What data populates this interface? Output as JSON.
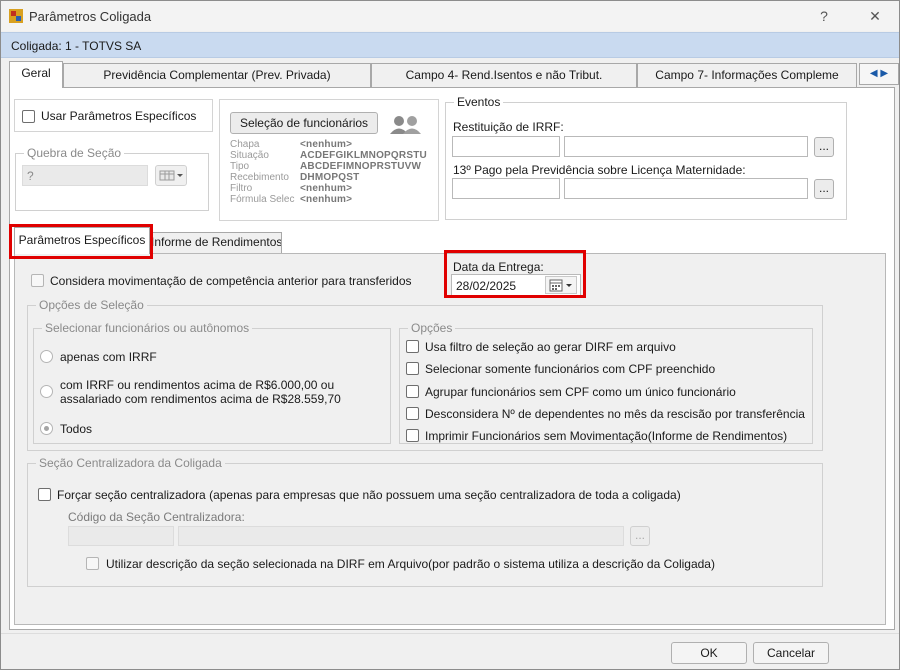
{
  "window": {
    "title": "Parâmetros Coligada",
    "help": "?",
    "close": "✕"
  },
  "coligada": "Coligada: 1 - TOTVS SA",
  "tabs": [
    "Geral",
    "Previdência Complementar (Prev. Privada)",
    "Campo 4- Rend.Isentos e não Tribut.",
    "Campo 7- Informações Compleme"
  ],
  "top": {
    "usar_parametros": "Usar Parâmetros Específicos",
    "quebra_secao": "Quebra de Seção",
    "quebra_value": "?",
    "selecao_button": "Seleção de funcionários",
    "selecao_info": [
      {
        "k": "Chapa",
        "v": "<nenhum>"
      },
      {
        "k": "Situação",
        "v": "ACDEFGIKLMNOPQRSTU"
      },
      {
        "k": "Tipo",
        "v": "ABCDEFIMNOPRSTUVW"
      },
      {
        "k": "Recebimento",
        "v": "DHMOPQST"
      },
      {
        "k": "Filtro",
        "v": "<nenhum>"
      },
      {
        "k": "Fórmula Selec",
        "v": "<nenhum>"
      }
    ],
    "eventos": "Eventos",
    "restituicao": "Restituição de IRRF:",
    "decimo": "13º Pago pela Previdência sobre Licença Maternidade:",
    "ellipsis": "..."
  },
  "subtabs": [
    "Parâmetros Específicos",
    "Informe de Rendimentos"
  ],
  "main": {
    "considera": "Considera movimentação de competência anterior para transferidos",
    "data_entrega_label": "Data da Entrega:",
    "data_entrega_value": "28/02/2025",
    "opcoes_selecao": "Opções de Seleção",
    "selecionar_func": "Selecionar funcionários ou autônomos",
    "radio1": "apenas com IRRF",
    "radio2a": "com IRRF ou rendimentos acima de R$6.000,00 ou",
    "radio2b": "assalariado com rendimentos acima de R$28.559,70",
    "radio3": "Todos",
    "opcoes": "Opções",
    "op": [
      "Usa filtro de seleção ao gerar DIRF em arquivo",
      "Selecionar somente funcionários com CPF preenchido",
      "Agrupar funcionários sem CPF como um único funcionário",
      "Desconsidera Nº de dependentes no mês da rescisão por transferência",
      "Imprimir Funcionários sem Movimentação(Informe de Rendimentos)"
    ],
    "secao_central": "Seção Centralizadora da Coligada",
    "forcar": "Forçar seção centralizadora  (apenas para empresas que não possuem uma seção centralizadora de toda a coligada)",
    "codigo": "Código da Seção Centralizadora:",
    "utilizar": "Utilizar descrição da seção selecionada na DIRF em Arquivo(por padrão o sistema utiliza a descrição da Coligada)"
  },
  "footer": {
    "ok": "OK",
    "cancel": "Cancelar"
  }
}
